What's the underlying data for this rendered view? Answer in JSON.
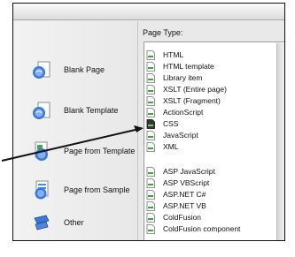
{
  "panel": {
    "page_type_label": "Page Type:"
  },
  "categories": [
    {
      "label": "Blank Page",
      "icon": "blank-page-icon"
    },
    {
      "label": "Blank Template",
      "icon": "blank-template-icon"
    },
    {
      "label": "Page from Template",
      "icon": "page-from-template-icon"
    },
    {
      "label": "Page from Sample",
      "icon": "page-from-sample-icon"
    },
    {
      "label": "Other",
      "icon": "other-icon"
    }
  ],
  "page_types": [
    {
      "label": "HTML",
      "icon": "document-icon"
    },
    {
      "label": "HTML template",
      "icon": "document-icon"
    },
    {
      "label": "Library item",
      "icon": "document-icon"
    },
    {
      "label": "XSLT (Entire page)",
      "icon": "document-icon"
    },
    {
      "label": "XSLT (Fragment)",
      "icon": "document-icon"
    },
    {
      "label": "ActionScript",
      "icon": "document-icon"
    },
    {
      "label": "CSS",
      "icon": "css-document-icon"
    },
    {
      "label": "JavaScript",
      "icon": "document-icon"
    },
    {
      "label": "XML",
      "icon": "document-icon"
    },
    {
      "label": "ASP JavaScript",
      "icon": "document-icon"
    },
    {
      "label": "ASP VBScript",
      "icon": "document-icon"
    },
    {
      "label": "ASP.NET C#",
      "icon": "document-icon"
    },
    {
      "label": "ASP.NET VB",
      "icon": "document-icon"
    },
    {
      "label": "ColdFusion",
      "icon": "document-icon"
    },
    {
      "label": "ColdFusion component",
      "icon": "document-icon"
    }
  ],
  "colors": {
    "doc_green": "#3fa43a",
    "css_dark": "#2f3b2f",
    "selection_arrow": "#111111"
  }
}
